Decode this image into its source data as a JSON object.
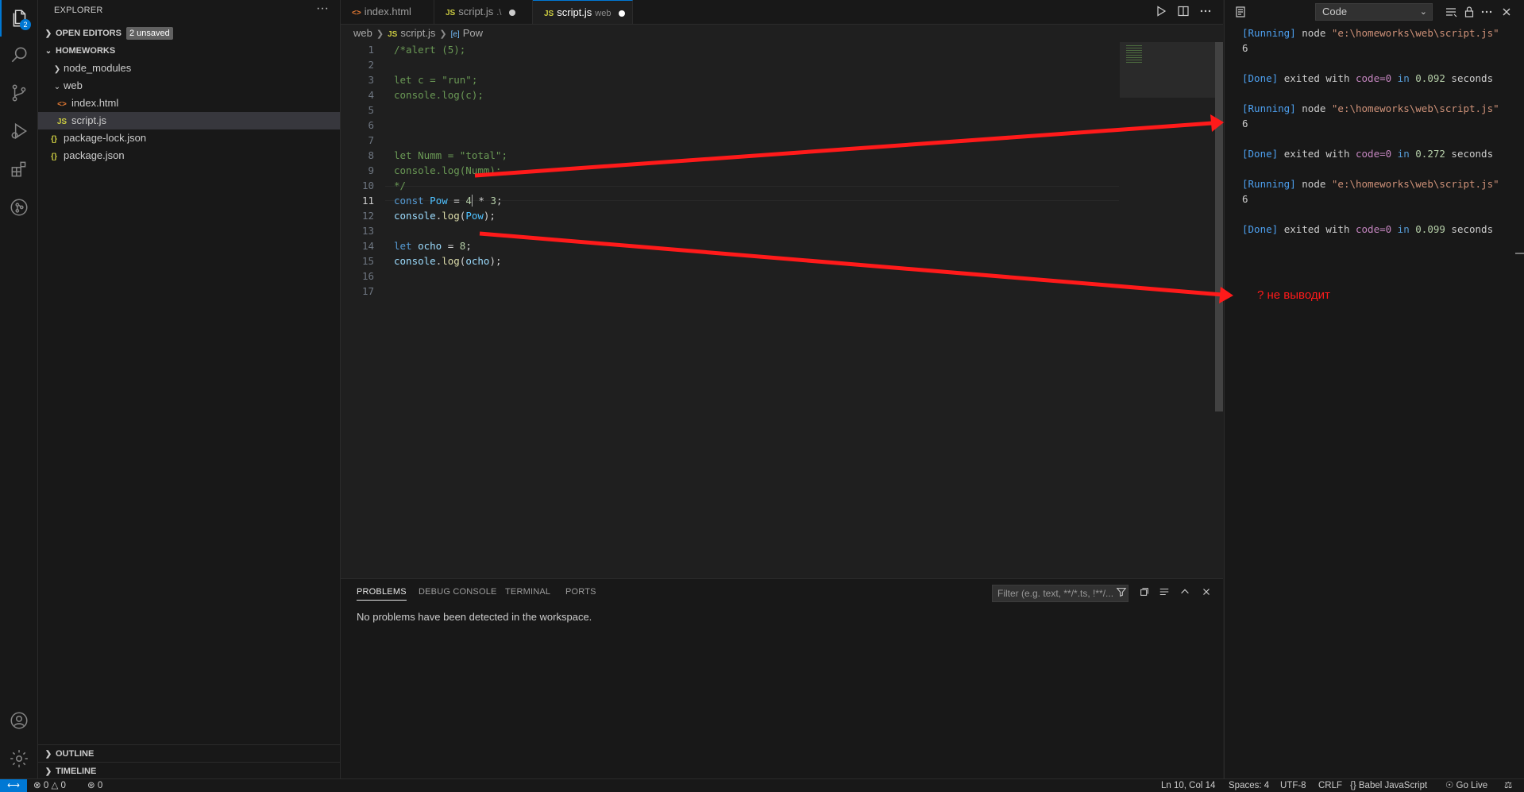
{
  "activity_bar": {
    "explorer_badge": "2"
  },
  "sidebar": {
    "title": "EXPLORER",
    "more": "···",
    "open_editors": {
      "label": "OPEN EDITORS",
      "badge": "2 unsaved"
    },
    "folder": "HOMEWORKS",
    "tree": [
      {
        "label": "node_modules"
      },
      {
        "label": "web"
      },
      {
        "label": "index.html",
        "icon": "<>"
      },
      {
        "label": "script.js",
        "icon": "JS"
      },
      {
        "label": "package-lock.json",
        "icon": "{}"
      },
      {
        "label": "package.json",
        "icon": "{}"
      }
    ],
    "outline": "OUTLINE",
    "timeline": "TIMELINE"
  },
  "tabs": [
    {
      "label": "index.html",
      "icon": "<>"
    },
    {
      "label": "script.js",
      "desc": ".\\",
      "icon": "JS"
    },
    {
      "label": "script.js",
      "desc": "web",
      "icon": "JS"
    }
  ],
  "breadcrumb": {
    "folder": "web",
    "file": "script.js",
    "symbol": "Pow",
    "file_icon": "JS",
    "symbol_icon": "[e]"
  },
  "editor": {
    "line_numbers": [
      "1",
      "2",
      "3",
      "4",
      "5",
      "6",
      "7",
      "8",
      "9",
      "10",
      "11",
      "12",
      "13",
      "14",
      "15",
      "16",
      "17"
    ],
    "current_line": "10"
  },
  "panel": {
    "tabs": [
      "PROBLEMS",
      "DEBUG CONSOLE",
      "TERMINAL",
      "PORTS"
    ],
    "filter_placeholder": "Filter (e.g. text, **/*.ts, !**/...",
    "message": "No problems have been detected in the workspace."
  },
  "output": {
    "channel": "Code",
    "runs": [
      {
        "running": "[Running]",
        "cmd": "node ",
        "path": "\"e:\\homeworks\\web\\script.js\"",
        "result": "6",
        "done": "[Done]",
        "exited": "exited with ",
        "code_label": "code=0",
        "in": " in ",
        "time": "0.092",
        "seconds": " seconds"
      },
      {
        "running": "[Running]",
        "cmd": "node ",
        "path": "\"e:\\homeworks\\web\\script.js\"",
        "result": "6",
        "done": "[Done]",
        "exited": "exited with ",
        "code_label": "code=0",
        "in": " in ",
        "time": "0.272",
        "seconds": " seconds"
      },
      {
        "running": "[Running]",
        "cmd": "node ",
        "path": "\"e:\\homeworks\\web\\script.js\"",
        "result": "6",
        "done": "[Done]",
        "exited": "exited with ",
        "code_label": "code=0",
        "in": " in ",
        "time": "0.099",
        "seconds": " seconds"
      }
    ]
  },
  "annotation": {
    "note": "? не выводит",
    "color": "#ff1a1a"
  },
  "statusbar": {
    "errors": "0",
    "warnings": "0",
    "ports": "0",
    "position": "Ln 10, Col 14",
    "spaces": "Spaces: 4",
    "encoding": "UTF-8",
    "eol": "CRLF",
    "language": "{} Babel JavaScript",
    "golive": "Go Live"
  },
  "colors": {
    "accent": "#0078d4",
    "comment": "#6a9955",
    "keyword": "#569cd6",
    "string": "#ce9178",
    "number": "#b5cea8"
  }
}
